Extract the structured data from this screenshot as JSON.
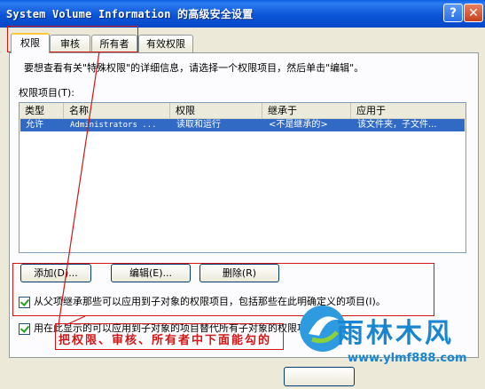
{
  "window": {
    "title": "System Volume Information 的高级安全设置",
    "help_glyph": "?",
    "close_glyph": "✕"
  },
  "tabs": [
    "权限",
    "审核",
    "所有者",
    "有效权限"
  ],
  "permissions": {
    "hint": "要想查看有关\"特殊权限\"的详细信息，请选择一个权限项目，然后单击\"编辑\"。",
    "list_label": "权限项目(T):",
    "columns": [
      "类型",
      "名称",
      "权限",
      "继承于",
      "应用于"
    ],
    "rows": [
      [
        "允许",
        "Administrators ...",
        "读取和运行",
        "<不是继承的>",
        "该文件夹，子文件..."
      ]
    ],
    "buttons": {
      "add": "添加(D)...",
      "edit": "编辑(E)...",
      "remove": "删除(R)"
    },
    "checkbox_inherit": "从父项继承那些可以应用到子对象的权限项目，包括那些在此明确定义的项目(I)。",
    "checkbox_replace": "用在此显示的可以应用到子对象的项目替代所有子对象的权限项目(P)"
  },
  "annotation": {
    "text": "把权限、审核、所有者中下面能勾的",
    "color": "#d01818"
  },
  "watermark": {
    "brand": "雨林木风",
    "url": "www.ylmf888.com",
    "color": "#1a86d0"
  },
  "colors": {
    "title_bar": "#0c55d8",
    "selection": "#316ac5",
    "dialog_bg": "#ece9d8",
    "annotation_red": "#d01818"
  }
}
